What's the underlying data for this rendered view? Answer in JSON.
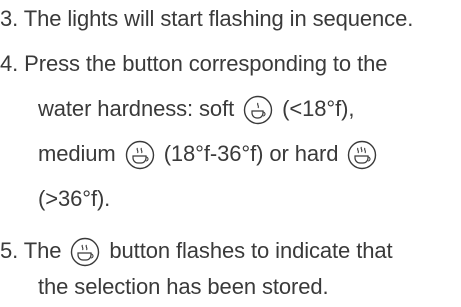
{
  "step3": {
    "text": "3. The lights will start flashing in sequence."
  },
  "step4": {
    "line1": "4. Press the button corresponding to the",
    "line2_prefix": "water hardness: soft",
    "line2_suffix": "(<18°f),",
    "line3_prefix": "medium",
    "line3_mid": "(18°f-36°f) or hard",
    "line4": "(>36°f).",
    "icons": [
      "soft-cup-icon",
      "medium-cup-icon",
      "hard-cup-icon"
    ]
  },
  "step5": {
    "line1_prefix": "5. The",
    "line1_suffix": "button flashes to indicate that",
    "line2": "the selection has been stored.",
    "icon": "medium-cup-icon"
  },
  "colors": {
    "text": "#3a3a3a",
    "icon_stroke": "#3a3a3a"
  }
}
